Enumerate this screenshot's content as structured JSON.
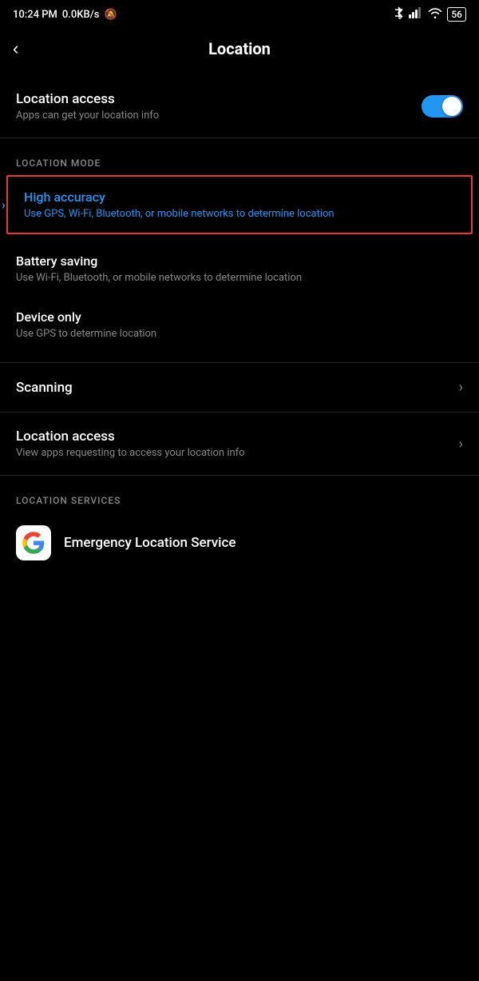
{
  "status_bar": {
    "time": "10:24 PM",
    "network": "0.0KB/s",
    "muted_icon": "mute-icon",
    "bluetooth_icon": "bluetooth-icon",
    "signal_icon": "signal-icon",
    "wifi_icon": "wifi-icon",
    "battery": "56"
  },
  "header": {
    "back_label": "‹",
    "title": "Location"
  },
  "location_access": {
    "main_label": "Location access",
    "sub_label": "Apps can get your location info",
    "toggle_on": true
  },
  "location_mode_section": {
    "section_label": "LOCATION MODE",
    "modes": [
      {
        "id": "high_accuracy",
        "title": "High accuracy",
        "desc": "Use GPS, Wi-Fi, Bluetooth, or mobile networks to determine location",
        "selected": true
      },
      {
        "id": "battery_saving",
        "title": "Battery saving",
        "desc": "Use Wi-Fi, Bluetooth, or mobile networks to determine location",
        "selected": false
      },
      {
        "id": "device_only",
        "title": "Device only",
        "desc": "Use GPS to determine location",
        "selected": false
      }
    ]
  },
  "menu_items": [
    {
      "id": "scanning",
      "main_label": "Scanning",
      "sub_label": "",
      "has_chevron": true
    },
    {
      "id": "location_access_apps",
      "main_label": "Location access",
      "sub_label": "View apps requesting to access your location info",
      "has_chevron": true
    }
  ],
  "location_services_section": {
    "section_label": "LOCATION SERVICES",
    "services": [
      {
        "id": "emergency_location",
        "icon": "google-icon",
        "label": "Emergency Location Service"
      }
    ]
  }
}
